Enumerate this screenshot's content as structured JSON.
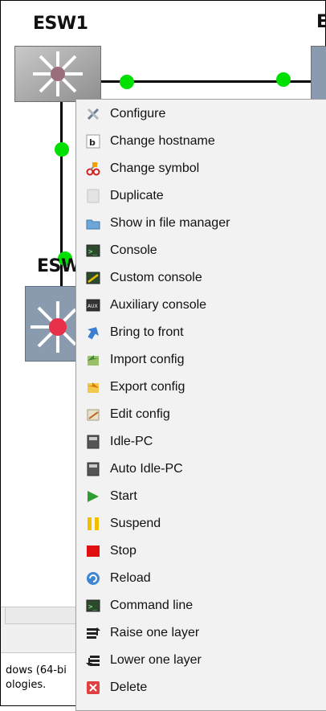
{
  "nodes": {
    "esw1_label": "ESW1",
    "esw2_label": "ESW",
    "esw_right_label": "E"
  },
  "log": {
    "line1": "dows (64-bi",
    "line2": "ologies."
  },
  "menu": {
    "items": [
      {
        "label": "Configure",
        "icon": "wrench-screwdriver-icon"
      },
      {
        "label": "Change hostname",
        "icon": "hostname-icon"
      },
      {
        "label": "Change symbol",
        "icon": "scissors-paint-icon"
      },
      {
        "label": "Duplicate",
        "icon": "duplicate-icon"
      },
      {
        "label": "Show in file manager",
        "icon": "folder-icon"
      },
      {
        "label": "Console",
        "icon": "console-icon"
      },
      {
        "label": "Custom console",
        "icon": "custom-console-icon"
      },
      {
        "label": "Auxiliary console",
        "icon": "aux-console-icon"
      },
      {
        "label": "Bring to front",
        "icon": "bring-front-icon"
      },
      {
        "label": "Import config",
        "icon": "import-icon"
      },
      {
        "label": "Export config",
        "icon": "export-icon"
      },
      {
        "label": "Edit config",
        "icon": "edit-icon"
      },
      {
        "label": "Idle-PC",
        "icon": "calculator-icon"
      },
      {
        "label": "Auto Idle-PC",
        "icon": "calculator-icon"
      },
      {
        "label": "Start",
        "icon": "play-icon"
      },
      {
        "label": "Suspend",
        "icon": "pause-icon"
      },
      {
        "label": "Stop",
        "icon": "stop-icon"
      },
      {
        "label": "Reload",
        "icon": "reload-icon"
      },
      {
        "label": "Command line",
        "icon": "terminal-icon"
      },
      {
        "label": "Raise one layer",
        "icon": "raise-layer-icon"
      },
      {
        "label": "Lower one layer",
        "icon": "lower-layer-icon"
      },
      {
        "label": "Delete",
        "icon": "delete-icon"
      }
    ]
  },
  "colors": {
    "link_dot": "#00e000",
    "switch_face": "#8a9bb0",
    "menu_bg": "#f2f2f2"
  }
}
